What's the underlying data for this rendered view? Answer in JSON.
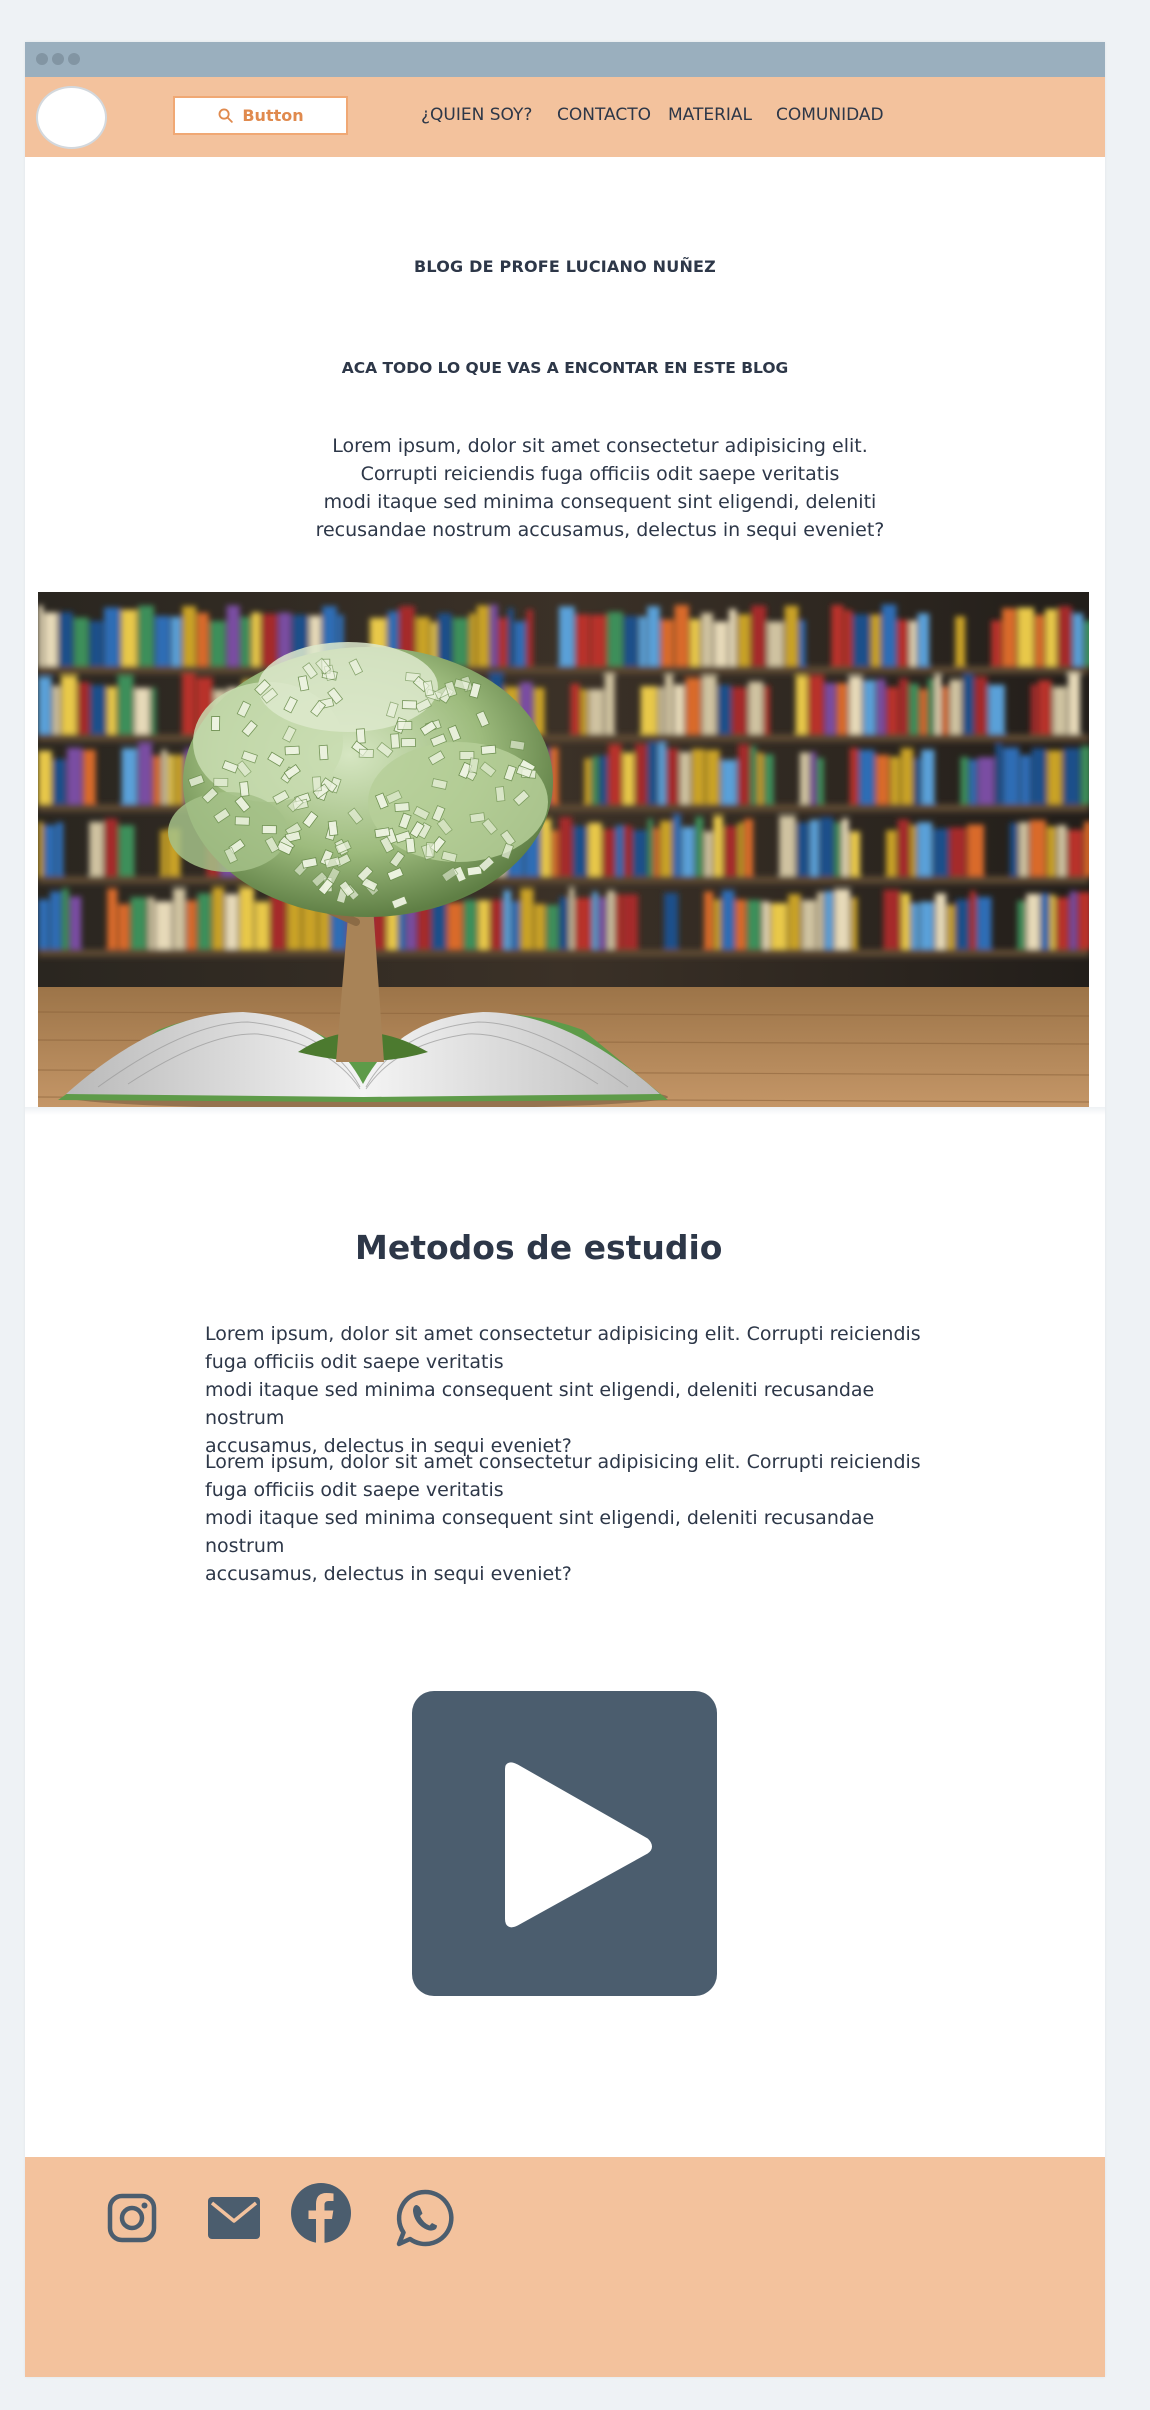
{
  "navbar": {
    "button_label": "Button",
    "links": [
      "¿QUIEN SOY?",
      "CONTACTO",
      "MATERIAL",
      "COMUNIDAD"
    ]
  },
  "hero": {
    "title": "BLOG DE PROFE LUCIANO NUÑEZ",
    "subtitle": "ACA TODO LO QUE VAS A ENCONTAR EN ESTE BLOG",
    "paragraph_lines": [
      "Lorem ipsum, dolor sit amet consectetur adipisicing elit.",
      "Corrupti reiciendis fuga officiis odit saepe veritatis",
      "modi itaque sed minima consequent sint eligendi, deleniti",
      "recusandae nostrum accusamus, delectus in sequi eveniet?"
    ]
  },
  "section": {
    "title": "Metodos de estudio",
    "paragraphs": [
      [
        "Lorem ipsum, dolor sit amet consectetur adipisicing elit. Corrupti reiciendis",
        "fuga officiis odit saepe veritatis",
        "modi itaque sed minima consequent sint eligendi, deleniti recusandae nostrum",
        "accusamus, delectus in sequi eveniet?"
      ],
      [
        "Lorem ipsum, dolor sit amet consectetur adipisicing elit. Corrupti reiciendis",
        "fuga officiis odit saepe veritatis",
        "modi itaque sed minima consequent sint eligendi, deleniti recusandae nostrum",
        "accusamus, delectus in sequi eveniet?"
      ]
    ]
  },
  "video": {
    "icon": "play-icon"
  },
  "footer": {
    "social_icons": [
      "instagram-icon",
      "mail-icon",
      "facebook-icon",
      "whatsapp-icon"
    ]
  },
  "colors": {
    "navbar_bg": "#f3c29d",
    "titlebar_bg": "#9aafbe",
    "accent": "#e08a4e",
    "text": "#2d3748",
    "video_bg": "#4b5d6e"
  }
}
